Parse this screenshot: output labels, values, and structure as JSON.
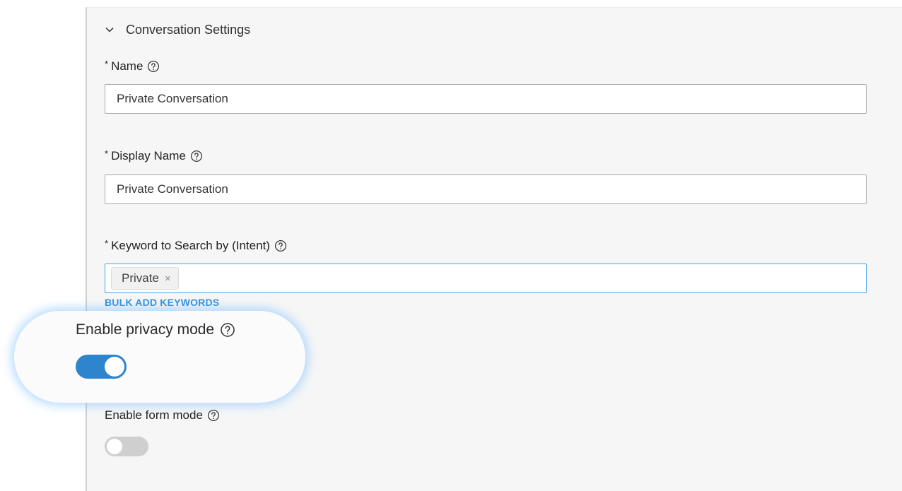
{
  "section": {
    "title": "Conversation Settings",
    "icon": "chevron-down-icon"
  },
  "fields": {
    "name": {
      "required_mark": "*",
      "label": "Name",
      "value": "Private Conversation"
    },
    "display_name": {
      "required_mark": "*",
      "label": "Display Name",
      "value": "Private Conversation"
    },
    "keyword": {
      "required_mark": "*",
      "label": "Keyword to Search by (Intent)",
      "tags": [
        {
          "label": "Private",
          "remove": "×"
        }
      ]
    }
  },
  "bulk_add_label": "BULK ADD KEYWORDS",
  "privacy_mode": {
    "label": "Enable privacy mode",
    "enabled": true
  },
  "form_mode": {
    "label": "Enable form mode",
    "enabled": false
  },
  "colors": {
    "accent": "#2d86cd",
    "link": "#2f8fe0",
    "focus_border": "#4aa3e6",
    "toggle_off": "#cfcfcf",
    "panel_bg": "#f6f6f6"
  }
}
